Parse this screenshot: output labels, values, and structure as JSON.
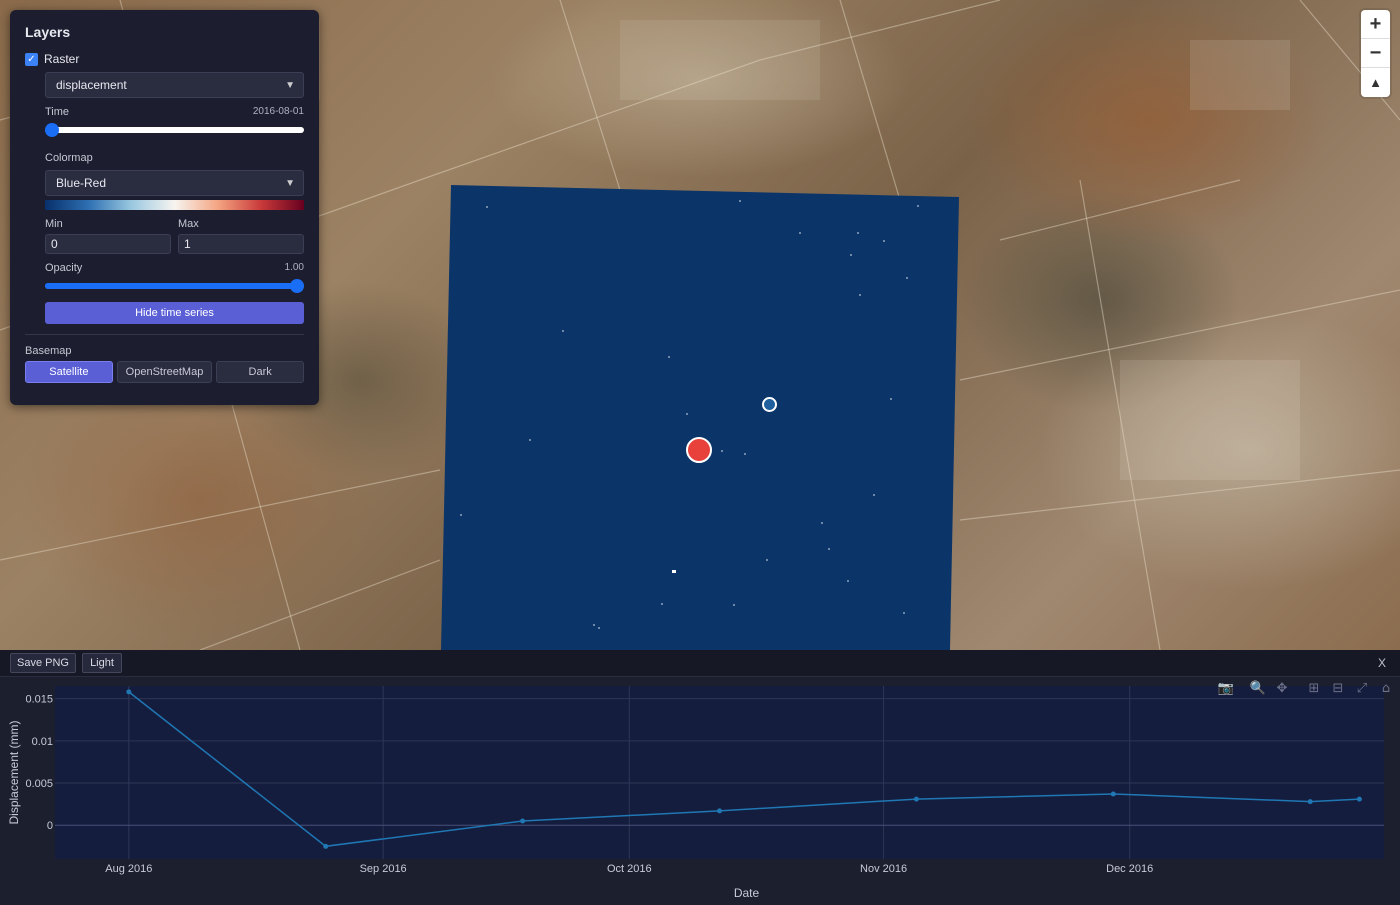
{
  "panel": {
    "title": "Layers",
    "raster_label": "Raster",
    "raster_checked": true,
    "layer_select": "displacement",
    "time_label": "Time",
    "time_value": "2016-08-01",
    "time_fraction": 0.0,
    "colormap_label": "Colormap",
    "colormap_select": "Blue-Red",
    "min_label": "Min",
    "min_value": "0",
    "max_label": "Max",
    "max_value": "1",
    "opacity_label": "Opacity",
    "opacity_value": "1.00",
    "opacity_fraction": 1.0,
    "hide_ts_button": "Hide time series",
    "basemap_label": "Basemap",
    "basemaps": [
      "Satellite",
      "OpenStreetMap",
      "Dark"
    ],
    "basemap_active": "Satellite"
  },
  "nav": {
    "zoom_in": "+",
    "zoom_out": "−",
    "compass": "▲"
  },
  "bottom_toolbar": {
    "save_png": "Save PNG",
    "theme": "Light",
    "close": "X"
  },
  "modebar": {
    "icons": [
      "camera-icon",
      "zoom-icon",
      "pan-icon",
      "zoom-in-icon",
      "zoom-out-icon",
      "autoscale-icon",
      "home-icon"
    ],
    "glyphs": [
      "📷",
      "🔍",
      "✥",
      "⊞",
      "⊟",
      "⤢",
      "⌂"
    ]
  },
  "colors": {
    "line": "#1f77b4",
    "plot_bg": "#151d3e",
    "accent": "#5b5fd6"
  },
  "chart_data": {
    "type": "line",
    "x_axis_type": "date",
    "xlabel": "Date",
    "ylabel": "Displacement (mm)",
    "x_tick_labels": [
      "Aug 2016",
      "Sep 2016",
      "Oct 2016",
      "Nov 2016",
      "Dec 2016"
    ],
    "x_tick_dates": [
      "2016-08-01",
      "2016-09-01",
      "2016-10-01",
      "2016-11-01",
      "2016-12-01"
    ],
    "y_ticks": [
      0,
      0.005,
      0.01,
      0.015
    ],
    "y_tick_labels": [
      "0",
      "0.005",
      "0.01",
      "0.015"
    ],
    "xlim": [
      "2016-07-23",
      "2017-01-01"
    ],
    "ylim": [
      -0.004,
      0.0165
    ],
    "grid": true,
    "series": [
      {
        "x": [
          "2016-08-01",
          "2016-08-25",
          "2016-09-18",
          "2016-10-12",
          "2016-11-05",
          "2016-11-29",
          "2016-12-23",
          "2016-12-29"
        ],
        "y": [
          0.0158,
          -0.0025,
          0.0005,
          0.0017,
          0.0031,
          0.0037,
          0.0028,
          0.0031
        ]
      }
    ]
  }
}
